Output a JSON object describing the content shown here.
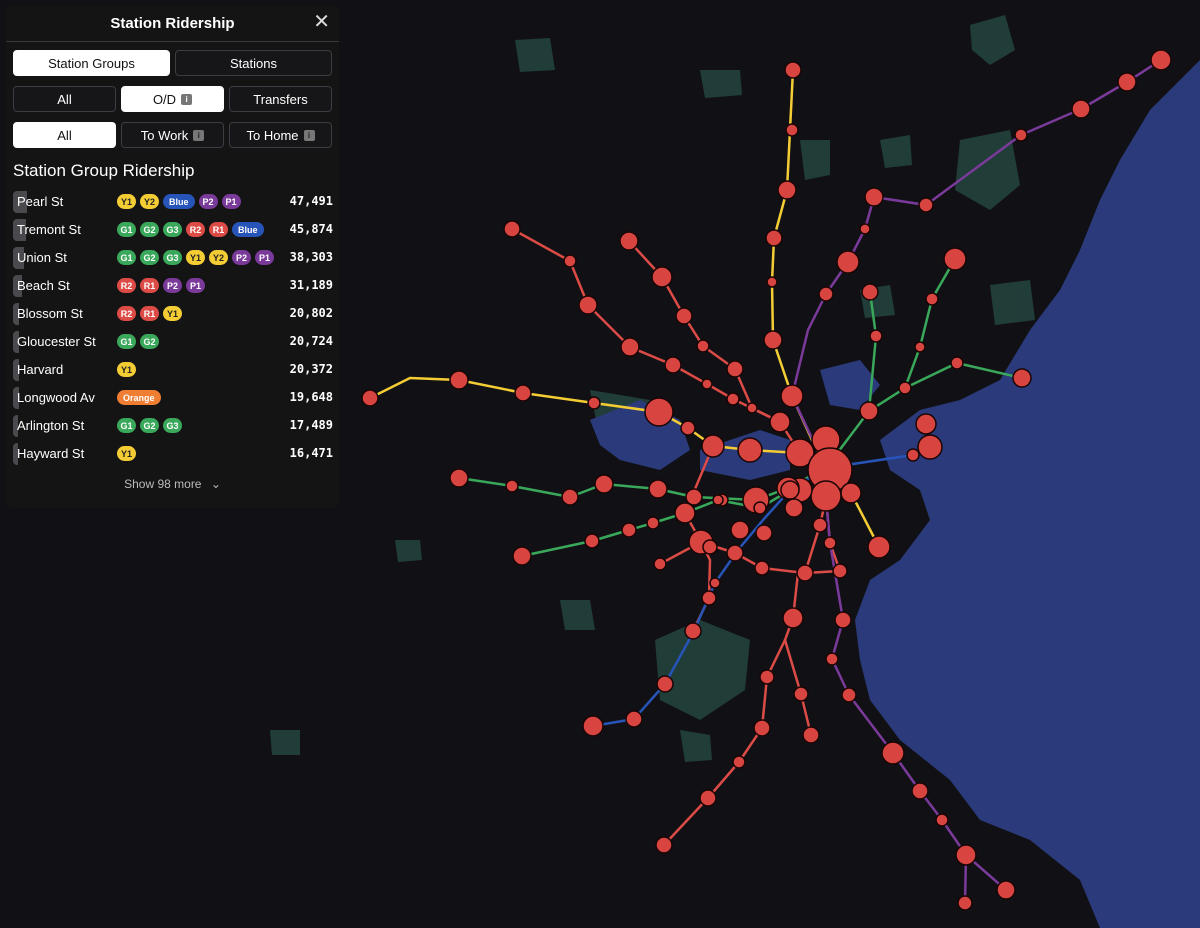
{
  "panel": {
    "title": "Station Ridership",
    "close_icon": "close-icon",
    "view_tabs": [
      "Station Groups",
      "Stations"
    ],
    "trip_tabs": [
      "All",
      "O/D",
      "Transfers"
    ],
    "direction_tabs": [
      "All",
      "To Work",
      "To Home"
    ],
    "section_title": "Station Group Ridership",
    "show_more": "Show 98 more",
    "chevron_icon": "chevron-down-icon",
    "rows": [
      {
        "name": "Pearl St",
        "lines": [
          "Y1",
          "Y2",
          "Blue",
          "P2",
          "P1"
        ],
        "value": "47,491",
        "fraction": 0.98
      },
      {
        "name": "Tremont St",
        "lines": [
          "G1",
          "G2",
          "G3",
          "R2",
          "R1",
          "Blue"
        ],
        "value": "45,874",
        "fraction": 0.95
      },
      {
        "name": "Union St",
        "lines": [
          "G1",
          "G2",
          "G3",
          "Y1",
          "Y2",
          "P2",
          "P1"
        ],
        "value": "38,303",
        "fraction": 0.8
      },
      {
        "name": "Beach St",
        "lines": [
          "R2",
          "R1",
          "P2",
          "P1"
        ],
        "value": "31,189",
        "fraction": 0.66
      },
      {
        "name": "Blossom St",
        "lines": [
          "R2",
          "R1",
          "Y1"
        ],
        "value": "20,802",
        "fraction": 0.44
      },
      {
        "name": "Gloucester St",
        "lines": [
          "G1",
          "G2"
        ],
        "value": "20,724",
        "fraction": 0.44
      },
      {
        "name": "Harvard",
        "lines": [
          "Y1"
        ],
        "value": "20,372",
        "fraction": 0.43
      },
      {
        "name": "Longwood Av",
        "lines": [
          "Orange"
        ],
        "value": "19,648",
        "fraction": 0.41
      },
      {
        "name": "Arlington St",
        "lines": [
          "G1",
          "G2",
          "G3"
        ],
        "value": "17,489",
        "fraction": 0.37
      },
      {
        "name": "Hayward St",
        "lines": [
          "Y1"
        ],
        "value": "16,471",
        "fraction": 0.35
      }
    ]
  },
  "colors": {
    "background": "#111115",
    "land_green": "#24453f",
    "water": "#2a3a7a",
    "station": "#d84440",
    "line_yellow": "#f4cd35",
    "line_green": "#3aa85a",
    "line_red": "#dc4b45",
    "line_purple": "#7a3a9a",
    "line_blue": "#2754b8",
    "line_orange": "#ef7d32"
  }
}
